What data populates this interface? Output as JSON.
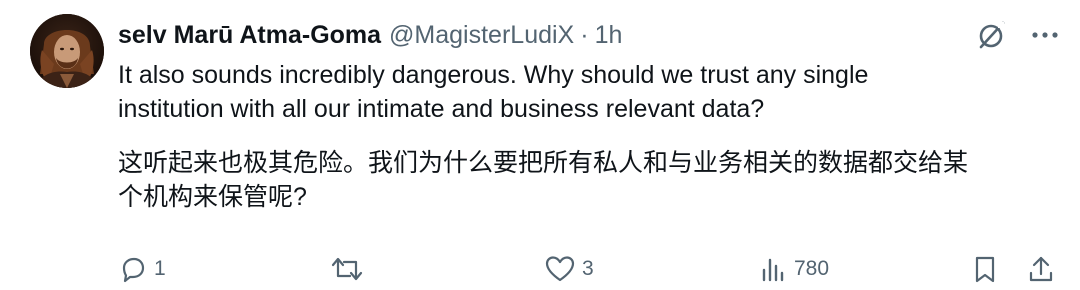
{
  "author": {
    "display_name": "selv Marū Atma-Goma",
    "handle": "@MagisterLudiX",
    "separator": "·",
    "time": "1h"
  },
  "tweet": {
    "text_en": "It also sounds incredibly dangerous.  Why should we trust any single institution with all our intimate and business relevant data?",
    "text_zh": "这听起来也极其危险。我们为什么要把所有私人和与业务相关的数据都交给某个机构来保管呢?"
  },
  "actions": {
    "reply_count": "1",
    "retweet_count": "",
    "like_count": "3",
    "view_count": "780"
  },
  "icons": {
    "grok": "grok-icon",
    "more": "more-icon",
    "reply": "reply-icon",
    "retweet": "retweet-icon",
    "like": "heart-icon",
    "views": "views-icon",
    "bookmark": "bookmark-icon",
    "share": "share-icon"
  },
  "colors": {
    "text_primary": "#0f1419",
    "text_secondary": "#536471",
    "background": "#ffffff"
  }
}
